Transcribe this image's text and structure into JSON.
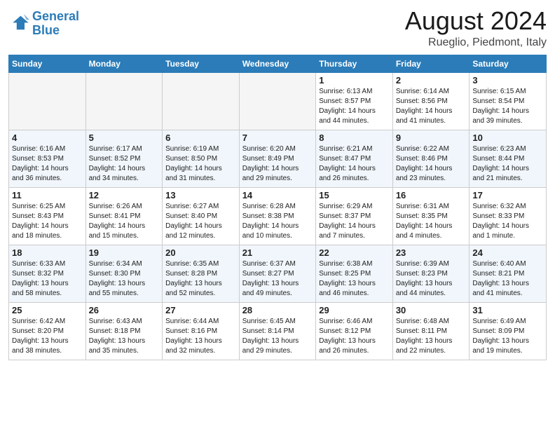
{
  "header": {
    "logo_line1": "General",
    "logo_line2": "Blue",
    "month_title": "August 2024",
    "location": "Rueglio, Piedmont, Italy"
  },
  "weekdays": [
    "Sunday",
    "Monday",
    "Tuesday",
    "Wednesday",
    "Thursday",
    "Friday",
    "Saturday"
  ],
  "weeks": [
    [
      {
        "day": "",
        "info": ""
      },
      {
        "day": "",
        "info": ""
      },
      {
        "day": "",
        "info": ""
      },
      {
        "day": "",
        "info": ""
      },
      {
        "day": "1",
        "info": "Sunrise: 6:13 AM\nSunset: 8:57 PM\nDaylight: 14 hours\nand 44 minutes."
      },
      {
        "day": "2",
        "info": "Sunrise: 6:14 AM\nSunset: 8:56 PM\nDaylight: 14 hours\nand 41 minutes."
      },
      {
        "day": "3",
        "info": "Sunrise: 6:15 AM\nSunset: 8:54 PM\nDaylight: 14 hours\nand 39 minutes."
      }
    ],
    [
      {
        "day": "4",
        "info": "Sunrise: 6:16 AM\nSunset: 8:53 PM\nDaylight: 14 hours\nand 36 minutes."
      },
      {
        "day": "5",
        "info": "Sunrise: 6:17 AM\nSunset: 8:52 PM\nDaylight: 14 hours\nand 34 minutes."
      },
      {
        "day": "6",
        "info": "Sunrise: 6:19 AM\nSunset: 8:50 PM\nDaylight: 14 hours\nand 31 minutes."
      },
      {
        "day": "7",
        "info": "Sunrise: 6:20 AM\nSunset: 8:49 PM\nDaylight: 14 hours\nand 29 minutes."
      },
      {
        "day": "8",
        "info": "Sunrise: 6:21 AM\nSunset: 8:47 PM\nDaylight: 14 hours\nand 26 minutes."
      },
      {
        "day": "9",
        "info": "Sunrise: 6:22 AM\nSunset: 8:46 PM\nDaylight: 14 hours\nand 23 minutes."
      },
      {
        "day": "10",
        "info": "Sunrise: 6:23 AM\nSunset: 8:44 PM\nDaylight: 14 hours\nand 21 minutes."
      }
    ],
    [
      {
        "day": "11",
        "info": "Sunrise: 6:25 AM\nSunset: 8:43 PM\nDaylight: 14 hours\nand 18 minutes."
      },
      {
        "day": "12",
        "info": "Sunrise: 6:26 AM\nSunset: 8:41 PM\nDaylight: 14 hours\nand 15 minutes."
      },
      {
        "day": "13",
        "info": "Sunrise: 6:27 AM\nSunset: 8:40 PM\nDaylight: 14 hours\nand 12 minutes."
      },
      {
        "day": "14",
        "info": "Sunrise: 6:28 AM\nSunset: 8:38 PM\nDaylight: 14 hours\nand 10 minutes."
      },
      {
        "day": "15",
        "info": "Sunrise: 6:29 AM\nSunset: 8:37 PM\nDaylight: 14 hours\nand 7 minutes."
      },
      {
        "day": "16",
        "info": "Sunrise: 6:31 AM\nSunset: 8:35 PM\nDaylight: 14 hours\nand 4 minutes."
      },
      {
        "day": "17",
        "info": "Sunrise: 6:32 AM\nSunset: 8:33 PM\nDaylight: 14 hours\nand 1 minute."
      }
    ],
    [
      {
        "day": "18",
        "info": "Sunrise: 6:33 AM\nSunset: 8:32 PM\nDaylight: 13 hours\nand 58 minutes."
      },
      {
        "day": "19",
        "info": "Sunrise: 6:34 AM\nSunset: 8:30 PM\nDaylight: 13 hours\nand 55 minutes."
      },
      {
        "day": "20",
        "info": "Sunrise: 6:35 AM\nSunset: 8:28 PM\nDaylight: 13 hours\nand 52 minutes."
      },
      {
        "day": "21",
        "info": "Sunrise: 6:37 AM\nSunset: 8:27 PM\nDaylight: 13 hours\nand 49 minutes."
      },
      {
        "day": "22",
        "info": "Sunrise: 6:38 AM\nSunset: 8:25 PM\nDaylight: 13 hours\nand 46 minutes."
      },
      {
        "day": "23",
        "info": "Sunrise: 6:39 AM\nSunset: 8:23 PM\nDaylight: 13 hours\nand 44 minutes."
      },
      {
        "day": "24",
        "info": "Sunrise: 6:40 AM\nSunset: 8:21 PM\nDaylight: 13 hours\nand 41 minutes."
      }
    ],
    [
      {
        "day": "25",
        "info": "Sunrise: 6:42 AM\nSunset: 8:20 PM\nDaylight: 13 hours\nand 38 minutes."
      },
      {
        "day": "26",
        "info": "Sunrise: 6:43 AM\nSunset: 8:18 PM\nDaylight: 13 hours\nand 35 minutes."
      },
      {
        "day": "27",
        "info": "Sunrise: 6:44 AM\nSunset: 8:16 PM\nDaylight: 13 hours\nand 32 minutes."
      },
      {
        "day": "28",
        "info": "Sunrise: 6:45 AM\nSunset: 8:14 PM\nDaylight: 13 hours\nand 29 minutes."
      },
      {
        "day": "29",
        "info": "Sunrise: 6:46 AM\nSunset: 8:12 PM\nDaylight: 13 hours\nand 26 minutes."
      },
      {
        "day": "30",
        "info": "Sunrise: 6:48 AM\nSunset: 8:11 PM\nDaylight: 13 hours\nand 22 minutes."
      },
      {
        "day": "31",
        "info": "Sunrise: 6:49 AM\nSunset: 8:09 PM\nDaylight: 13 hours\nand 19 minutes."
      }
    ]
  ]
}
